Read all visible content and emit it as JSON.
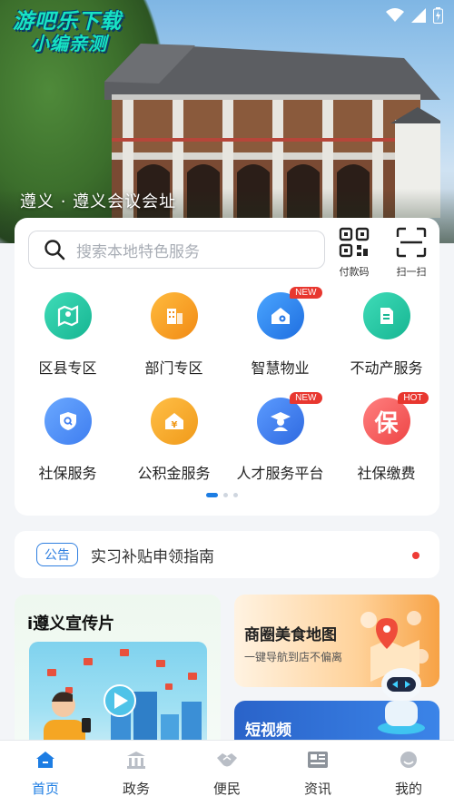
{
  "hero": {
    "logo_line1": "游吧乐下载",
    "logo_line2": "小编亲测",
    "location": "遵义 · 遵义会议会址"
  },
  "search": {
    "placeholder": "搜索本地特色服务"
  },
  "quick_actions": [
    {
      "label": "付款码",
      "icon": "qr-code-icon"
    },
    {
      "label": "扫一扫",
      "icon": "scan-icon"
    }
  ],
  "services": [
    {
      "label": "区县专区",
      "icon": "map-icon",
      "color": "#20c6a3",
      "badge": ""
    },
    {
      "label": "部门专区",
      "icon": "building-icon",
      "color": "#f59b1f",
      "badge": ""
    },
    {
      "label": "智慧物业",
      "icon": "house-gear-icon",
      "color": "#2f86ea",
      "badge": "NEW"
    },
    {
      "label": "不动产服务",
      "icon": "document-icon",
      "color": "#1fc3a0",
      "badge": ""
    },
    {
      "label": "社保服务",
      "icon": "shield-search-icon",
      "color": "#3f86f2",
      "badge": ""
    },
    {
      "label": "公积金服务",
      "icon": "yuan-house-icon",
      "color": "#f5a325",
      "badge": ""
    },
    {
      "label": "人才服务平台",
      "icon": "graduate-icon",
      "color": "#3b7ff0",
      "badge": "NEW"
    },
    {
      "label": "社保缴费",
      "icon": "bao-icon",
      "color": "#f35a5a",
      "badge": "HOT",
      "glyph": "保"
    }
  ],
  "notice": {
    "tag": "公告",
    "text": "实习补贴申领指南"
  },
  "promos": {
    "left_title": "i遵义宣传片",
    "right_top_title": "商圈美食地图",
    "right_top_subtitle": "一键导航到店不偏离",
    "right_bottom_title": "短视频"
  },
  "tabs": [
    {
      "label": "首页",
      "icon": "home-icon",
      "active": true
    },
    {
      "label": "政务",
      "icon": "government-icon",
      "active": false
    },
    {
      "label": "便民",
      "icon": "handshake-icon",
      "active": false
    },
    {
      "label": "资讯",
      "icon": "news-icon",
      "active": false
    },
    {
      "label": "我的",
      "icon": "user-icon",
      "active": false
    }
  ],
  "colors": {
    "accent": "#1d7de3",
    "notice_dot": "#ee3b35",
    "badge": "#e8372f"
  }
}
